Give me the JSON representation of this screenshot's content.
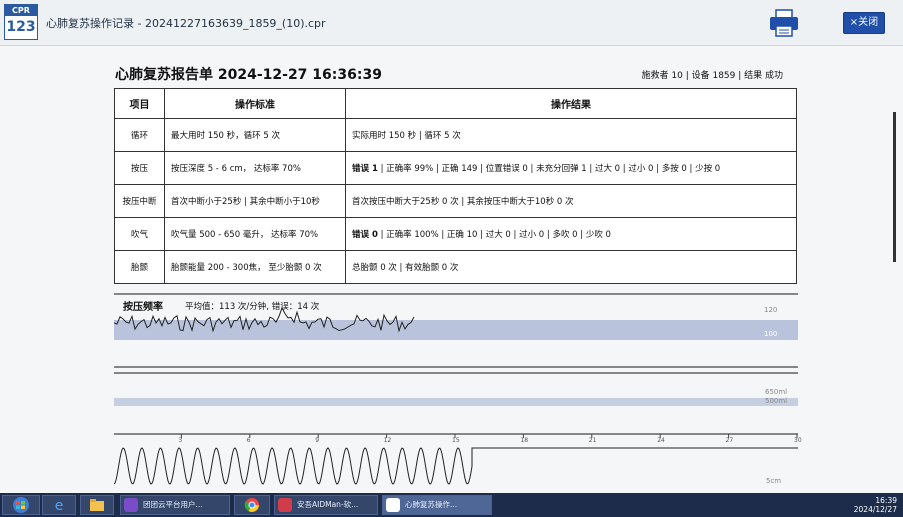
{
  "window": {
    "logo_top": "CPR",
    "logo_num": "123",
    "title": "心肺复苏操作记录 - 20241227163639_1859_(10).cpr",
    "close_label": "×关闭"
  },
  "report": {
    "title": "心肺复苏报告单 2024-12-27  16:36:39",
    "meta": "施救者 10 | 设备 1859 | 结果 成功",
    "headers": {
      "item": "项目",
      "standard": "操作标准",
      "result": "操作结果"
    },
    "rows": [
      {
        "item": "循环",
        "standard": "最大用时 150 秒，循环 5 次",
        "result_bold": "",
        "result": "实际用时 150 秒 | 循环 5 次"
      },
      {
        "item": "按压",
        "standard": "按压深度 5 - 6 cm， 达标率 70%",
        "result_bold": "错误 1",
        "result": "  | 正确率 99% | 正确 149 | 位置错误 0 | 未充分回弹 1 | 过大 0 | 过小 0 | 多按 0 | 少按 0"
      },
      {
        "item": "按压中断",
        "standard": "首次中断小于25秒 | 其余中断小于10秒",
        "result_bold": "",
        "result": "首次按压中断大于25秒 0 次 | 其余按压中断大于10秒  0 次"
      },
      {
        "item": "吹气",
        "standard": "吹气量 500 - 650 毫升， 达标率 70%",
        "result_bold": "错误 0",
        "result": "  | 正确率 100% | 正确 10 | 过大 0 | 过小 0 | 多吹 0 | 少吹 0"
      },
      {
        "item": "胎颤",
        "standard": "胎颤能量 200 - 300焦， 至少胎颤 0 次",
        "result_bold": "",
        "result": "总胎颤 0 次 | 有效胎颤 0 次"
      }
    ]
  },
  "freq": {
    "title": "按压频率",
    "avg": "平均值：113 次/分钟, 错误：14 次",
    "axis_top": "120",
    "axis_band": "100"
  },
  "vent": {
    "axis_top": "650ml",
    "axis_bottom": "500ml"
  },
  "timeline": {
    "ticks": [
      "3",
      "6",
      "9",
      "12",
      "15",
      "18",
      "21",
      "24",
      "27",
      "30"
    ],
    "depth_label": "5cm"
  },
  "taskbar": {
    "items": [
      "团团云平台用户...",
      "",
      "安吾AIDMan-软...",
      "心肺复苏操作..."
    ],
    "time": "16:39",
    "date": "2024/12/27"
  },
  "colors": {
    "band": "#b9c4dc",
    "close": "#1f4fa8",
    "taskbar": "#1c2c4a"
  }
}
